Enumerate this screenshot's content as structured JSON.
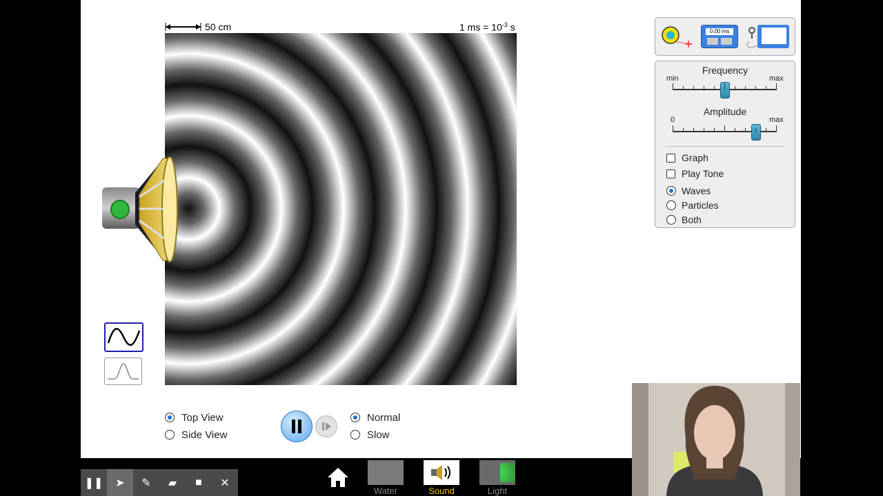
{
  "scale": {
    "distance_label": "50 cm",
    "time_label_base": "1 ms = 10",
    "time_label_exp": "-3",
    "time_label_unit": " s"
  },
  "frequency": {
    "title": "Frequency",
    "min_label": "min",
    "max_label": "max",
    "value": 0.5
  },
  "amplitude": {
    "title": "Amplitude",
    "min_label": "0",
    "max_label": "max",
    "value": 0.8
  },
  "checkboxes": [
    {
      "label": "Graph",
      "checked": false
    },
    {
      "label": "Play Tone",
      "checked": false
    }
  ],
  "view_mode": [
    {
      "label": "Waves",
      "selected": true
    },
    {
      "label": "Particles",
      "selected": false
    },
    {
      "label": "Both",
      "selected": false
    }
  ],
  "view_orientation": [
    {
      "label": "Top View",
      "selected": true
    },
    {
      "label": "Side View",
      "selected": false
    }
  ],
  "speed": [
    {
      "label": "Normal",
      "selected": true
    },
    {
      "label": "Slow",
      "selected": false
    }
  ],
  "stopwatch": {
    "display": "0.00 ms"
  },
  "nav": {
    "water": "Water",
    "sound": "Sound",
    "light": "Light"
  },
  "colors": {
    "accent": "#1f6fe0",
    "thumb": "#3fa2c4",
    "sound_tab_label": "#f6c300"
  }
}
